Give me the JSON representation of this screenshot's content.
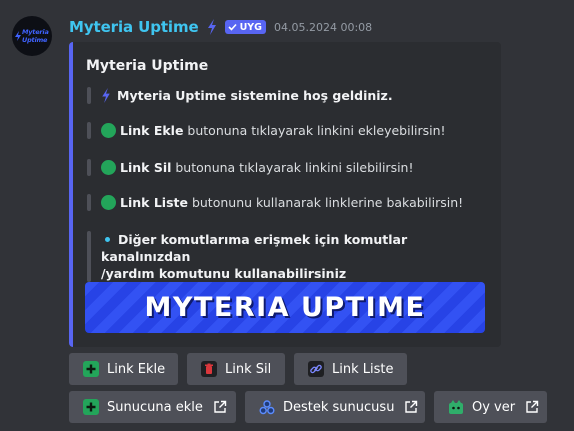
{
  "message": {
    "username": "Myteria Uptime",
    "app_badge": "UYG",
    "timestamp": "04.05.2024 00:08",
    "avatar_text": "Myteria\nUptime"
  },
  "embed": {
    "title": "Myteria Uptime",
    "welcome": "Myteria Uptime sistemine hoş geldiniz.",
    "add_bold": "Link Ekle",
    "add_text": " butonuna tıklayarak linkini ekleyebilirsin!",
    "del_bold": "Link Sil",
    "del_text": " butonuna tıklayarak linkini silebilirsin!",
    "list_bold": "Link Liste",
    "list_text": " butonunu kullanarak linklerine bakabilirsin!",
    "commands_line1": "Diğer komutlarıma erişmek için komutlar kanalınızdan",
    "commands_line2": "/yardım komutunu kullanabilirsiniz",
    "banner": "MYTERIA UPTIME"
  },
  "buttons": {
    "link_ekle": "Link Ekle",
    "link_sil": "Link Sil",
    "link_liste": "Link Liste",
    "sunucuna_ekle": "Sunucuna ekle",
    "destek_sunucusu": "Destek sunucusu",
    "oy_ver": "Oy ver"
  },
  "colors": {
    "accent": "#5865f2",
    "username": "#3fc5f0",
    "success": "#23a55a",
    "danger": "#da373c"
  }
}
